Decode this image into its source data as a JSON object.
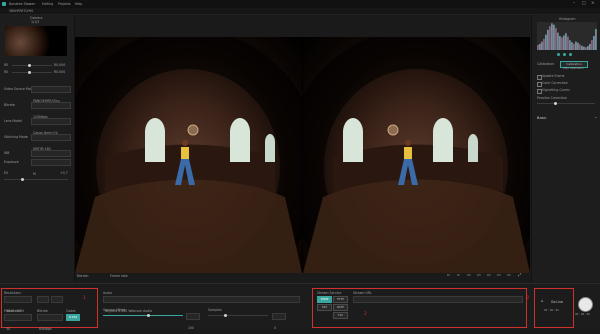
{
  "app": {
    "title": "Nunatee Stowen",
    "menu": [
      "Editing",
      "Projects",
      "Help"
    ]
  },
  "left": {
    "tab": "360HFRETLYHS",
    "camera_label": "Camera",
    "camera_sub": "1/1/3",
    "rows": [
      {
        "label": "R0",
        "value": "R0.000"
      },
      {
        "label": "R0",
        "value": "R0.000"
      }
    ],
    "source_label": "Video Source Mode",
    "source_value": "PANO/EHRE/Olsu",
    "bitrate_label": "Bitrate",
    "bitrate_value": "120Mbps",
    "lens_label": "Lens Model",
    "lens_value": "Canon 8mm f/4",
    "stitch_label": "Stitching Mode",
    "stitch_value": "SMT/M 180",
    "wb_label": "WB",
    "wb_value": "Auto",
    "exposure_label": "Exposure",
    "exposure_value": "M",
    "ev_label": "EV",
    "ev_value": "+0.7"
  },
  "viewer": {
    "status_left": "Bitrate:",
    "status_mid": "Frame rate:"
  },
  "right": {
    "histogram_label": "Histogram",
    "calibration_label": "Calibration",
    "calibration_button": "Calibration",
    "calibration_hint": "Auto calibration",
    "options": [
      {
        "label": "Update Frame"
      },
      {
        "label": "Color Correction"
      },
      {
        "label": "Vignetting Correc"
      }
    ],
    "parallax_label": "Parallax Correction",
    "section_label": "Basic",
    "histogram_bars": [
      0.18,
      0.22,
      0.3,
      0.4,
      0.55,
      0.72,
      0.85,
      0.95,
      0.9,
      0.78,
      0.62,
      0.5,
      0.45,
      0.52,
      0.6,
      0.48,
      0.35,
      0.28,
      0.22,
      0.3,
      0.26,
      0.2,
      0.15,
      0.12,
      0.1,
      0.14,
      0.22,
      0.35,
      0.5,
      0.75
    ]
  },
  "bottom": {
    "resolution_label": "Resolution",
    "resolution_value": "3840x1920",
    "resolution_w": "",
    "resolution_h": "",
    "framerate_label": "Frame rate",
    "bitrate_label": "Bitrate",
    "codec_label": "Codec",
    "framerate_value": "30",
    "bitrate_value": "60Mbps",
    "codec_value": "H.264",
    "number1": "1",
    "audio_label": "Audio",
    "audio_value": "Beyond 4-360 Webcam Audio",
    "volume_label": "Volume Offset",
    "volume_value": "100",
    "samples_label": "Samples",
    "samples_value": "0",
    "stream_label": "Stream Service",
    "stream_options": [
      "RTMP",
      "HTTP",
      "SRT",
      "RSTP",
      "FLV"
    ],
    "stream_url_label": "Stream URL",
    "number2": "2",
    "number3": "3",
    "golive_label": "Go Live",
    "golive_time": "00 : 00 : 00"
  }
}
